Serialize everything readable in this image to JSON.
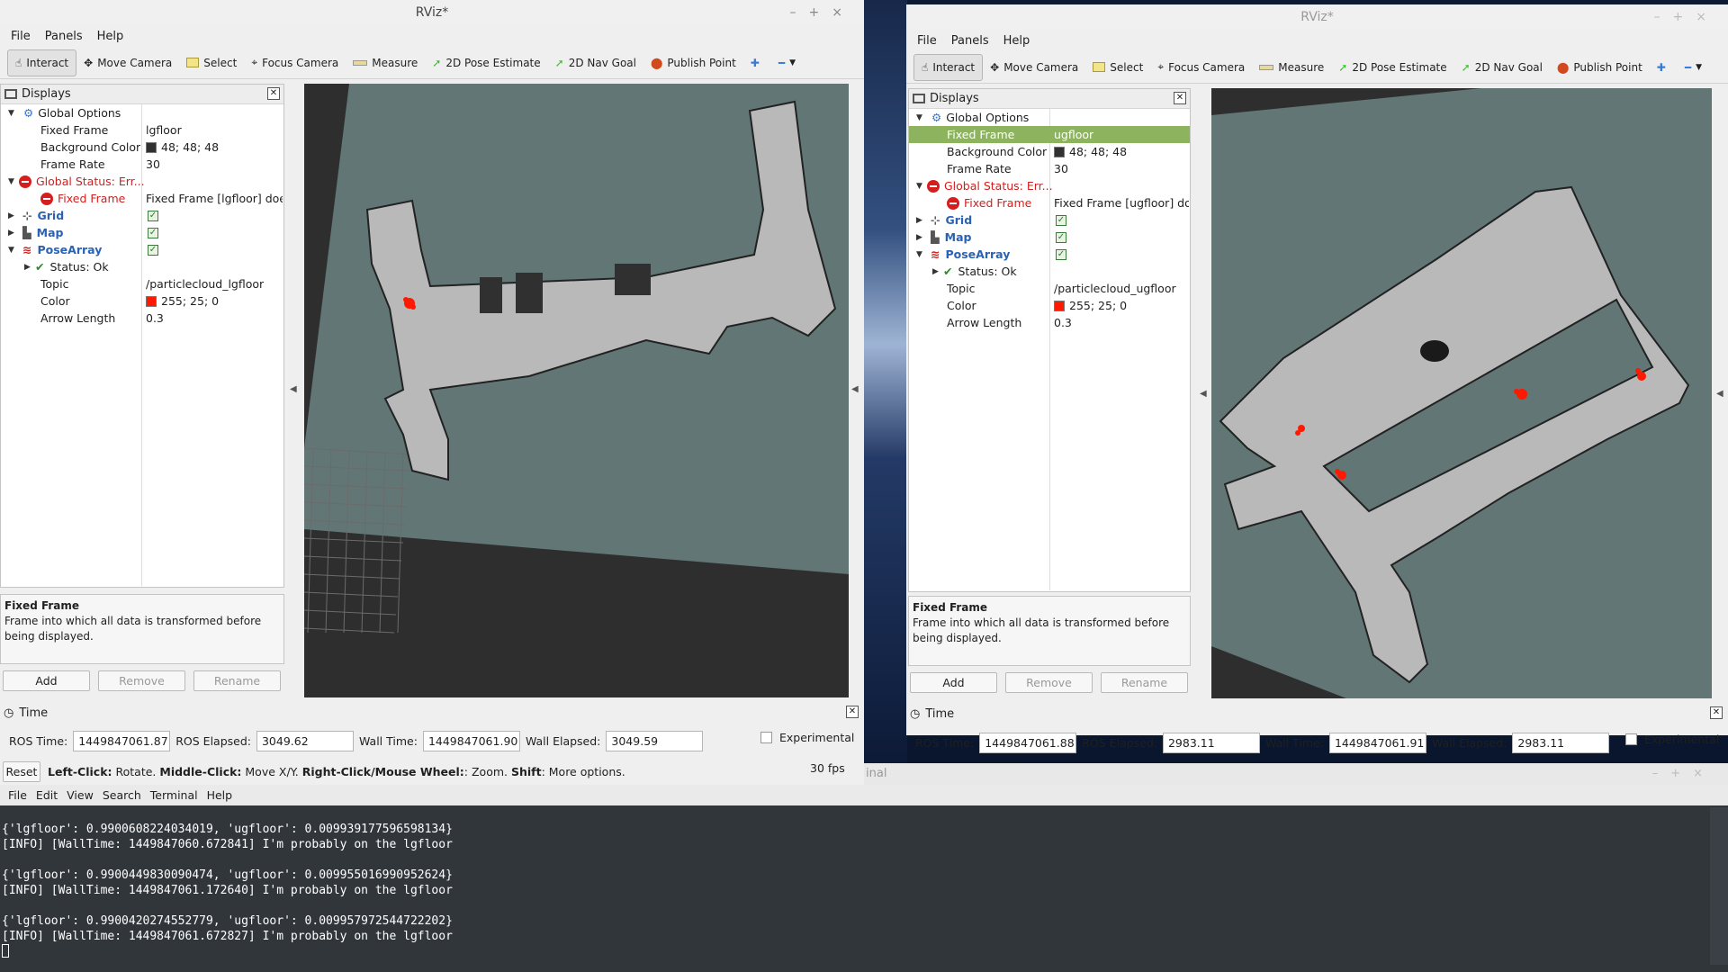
{
  "left": {
    "title": "RViz*",
    "menu": [
      "File",
      "Panels",
      "Help"
    ],
    "tools": [
      {
        "label": "Interact",
        "icon": "cursor-icon"
      },
      {
        "label": "Move Camera",
        "icon": "move-icon"
      },
      {
        "label": "Select",
        "icon": "select-icon"
      },
      {
        "label": "Focus Camera",
        "icon": "focus-icon"
      },
      {
        "label": "Measure",
        "icon": "ruler-icon"
      },
      {
        "label": "2D Pose Estimate",
        "icon": "pose-arrow-icon"
      },
      {
        "label": "2D Nav Goal",
        "icon": "goal-arrow-icon"
      },
      {
        "label": "Publish Point",
        "icon": "pin-icon"
      }
    ],
    "displays": {
      "title": "Displays",
      "global_options": "Global Options",
      "fixed_frame_label": "Fixed Frame",
      "fixed_frame_value": "lgfloor",
      "bg_color_label": "Background Color",
      "bg_color_value": "48; 48; 48",
      "frame_rate_label": "Frame Rate",
      "frame_rate_value": "30",
      "global_status": "Global Status: Err...",
      "status_fixed_frame": "Fixed Frame",
      "status_fixed_frame_value": "Fixed Frame [lgfloor] doe...",
      "grid": "Grid",
      "map": "Map",
      "posearray": "PoseArray",
      "status_ok": "Status: Ok",
      "topic_label": "Topic",
      "topic_value": "/particlecloud_lgfloor",
      "color_label": "Color",
      "color_value": "255; 25; 0",
      "arrow_label": "Arrow Length",
      "arrow_value": "0.3"
    },
    "desc_title": "Fixed Frame",
    "desc_text": "Frame into which all data is transformed before being displayed.",
    "buttons": {
      "add": "Add",
      "remove": "Remove",
      "rename": "Rename"
    },
    "time": {
      "title": "Time",
      "ros_time_label": "ROS Time:",
      "ros_time": "1449847061.87",
      "ros_elapsed_label": "ROS Elapsed:",
      "ros_elapsed": "3049.62",
      "wall_time_label": "Wall Time:",
      "wall_time": "1449847061.90",
      "wall_elapsed_label": "Wall Elapsed:",
      "wall_elapsed": "3049.59",
      "experimental": "Experimental"
    },
    "status": {
      "reset": "Reset",
      "hint_1b": "Left-Click:",
      "hint_1": " Rotate. ",
      "hint_2b": "Middle-Click:",
      "hint_2": " Move X/Y. ",
      "hint_3b": "Right-Click/Mouse Wheel:",
      "hint_3": ": Zoom. ",
      "hint_4b": "Shift",
      "hint_4": ": More options.",
      "fps": "30 fps"
    }
  },
  "right": {
    "title": "RViz*",
    "menu": [
      "File",
      "Panels",
      "Help"
    ],
    "displays": {
      "title": "Displays",
      "global_options": "Global Options",
      "fixed_frame_label": "Fixed Frame",
      "fixed_frame_value": "ugfloor",
      "bg_color_label": "Background Color",
      "bg_color_value": "48; 48; 48",
      "frame_rate_label": "Frame Rate",
      "frame_rate_value": "30",
      "global_status": "Global Status: Err...",
      "status_fixed_frame": "Fixed Frame",
      "status_fixed_frame_value": "Fixed Frame [ugfloor] do...",
      "grid": "Grid",
      "map": "Map",
      "posearray": "PoseArray",
      "status_ok": "Status: Ok",
      "topic_label": "Topic",
      "topic_value": "/particlecloud_ugfloor",
      "color_label": "Color",
      "color_value": "255; 25; 0",
      "arrow_label": "Arrow Length",
      "arrow_value": "0.3"
    },
    "desc_title": "Fixed Frame",
    "desc_text": "Frame into which all data is transformed before being displayed.",
    "buttons": {
      "add": "Add",
      "remove": "Remove",
      "rename": "Rename"
    },
    "time": {
      "title": "Time",
      "ros_time_label": "ROS Time:",
      "ros_time": "1449847061.88",
      "ros_elapsed_label": "ROS Elapsed:",
      "ros_elapsed": "2983.11",
      "wall_time_label": "Wall Time:",
      "wall_time": "1449847061.91",
      "wall_elapsed_label": "Wall Elapsed:",
      "wall_elapsed": "2983.11",
      "experimental": "Experimental"
    }
  },
  "terminal": {
    "title_fragment": "inal",
    "menu": [
      "File",
      "Edit",
      "View",
      "Search",
      "Terminal",
      "Help"
    ],
    "lines": [
      "{'lgfloor': 0.9900608224034019, 'ugfloor': 0.009939177596598134}",
      "[INFO] [WallTime: 1449847060.672841] I'm probably on the lgfloor",
      "",
      "{'lgfloor': 0.9900449830090474, 'ugfloor': 0.009955016990952624}",
      "[INFO] [WallTime: 1449847061.172640] I'm probably on the lgfloor",
      "",
      "{'lgfloor': 0.9900420274552779, 'ugfloor': 0.009957972544722202}",
      "[INFO] [WallTime: 1449847061.672827] I'm probably on the lgfloor"
    ]
  },
  "colors": {
    "map_free": "#b9b9b9",
    "map_unknown": "#607474",
    "bg": "#303030",
    "particles": "#ff1900",
    "selected_row": "#8db35e"
  }
}
